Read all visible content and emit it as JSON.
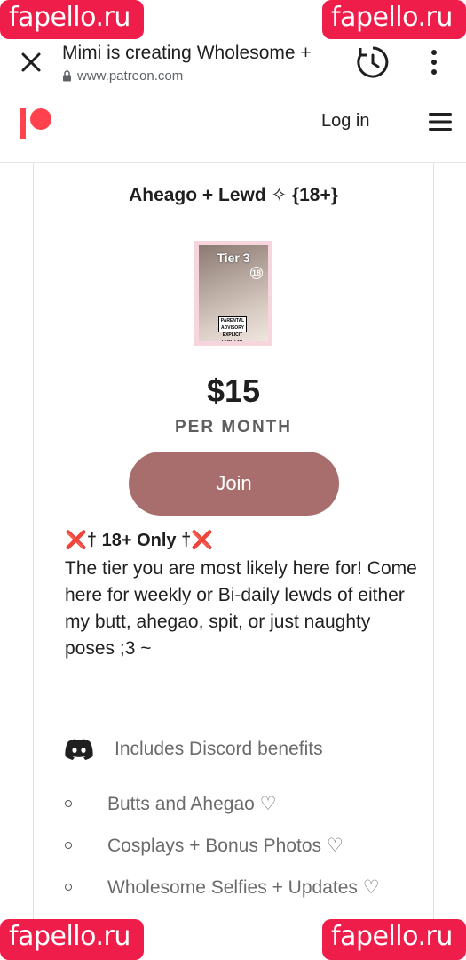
{
  "browser": {
    "tab_title": "Mimi is creating Wholesome +",
    "url": "www.patreon.com"
  },
  "nav": {
    "login_label": "Log in"
  },
  "tier": {
    "title": "Aheago + Lewd ✧ {18+}",
    "image_label": "Tier 3",
    "image_badge": "18",
    "image_advisory": "PARENTAL ADVISORY EXPLICIT CONTENT",
    "price": "$15",
    "period": "PER MONTH",
    "join_label": "Join",
    "heading": "❌† 18+ Only †❌",
    "description": "The tier you are most likely here for! Come here for weekly or Bi-daily lewds of either my butt, ahegao, spit, or just naughty poses ;3 ~",
    "discord_label": "Includes Discord benefits",
    "benefits": [
      "Butts and Ahegao ♡",
      "Cosplays + Bonus Photos ♡",
      "Wholesome Selfies + Updates ♡"
    ]
  },
  "watermark": {
    "text": "fapello.ru"
  },
  "colors": {
    "join_button": "#a86e6e",
    "patreon_brand": "#ff424d",
    "watermark": "#ef1d4a"
  }
}
